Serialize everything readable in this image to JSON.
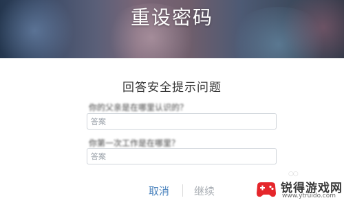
{
  "header": {
    "title": "重设密码"
  },
  "section": {
    "title": "回答安全提示问题"
  },
  "questions": [
    {
      "label": "你的父亲是在哪里认识的？",
      "placeholder": "答案"
    },
    {
      "label": "你第一次工作是在哪里？",
      "placeholder": "答案"
    }
  ],
  "actions": {
    "cancel_label": "取消",
    "continue_label": "继续"
  },
  "watermark": {
    "name": "锐得游戏网",
    "url": "www.ytruido.com"
  },
  "colors": {
    "link": "#4f86bf",
    "disabled": "#a8adb3",
    "watermark_accent": "#e5262b"
  }
}
